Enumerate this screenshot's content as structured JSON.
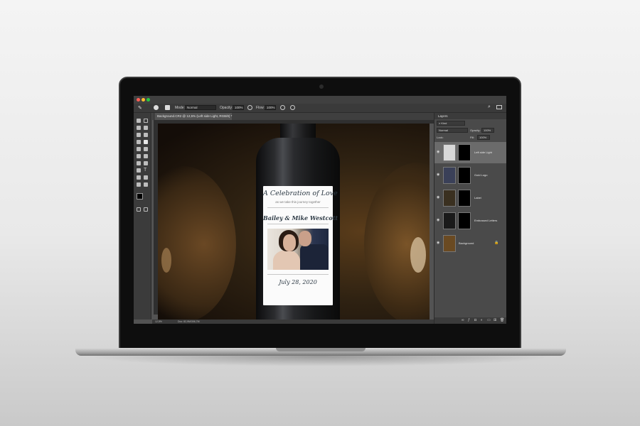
{
  "app": {
    "mode_label": "Mode:",
    "mode_value": "Normal",
    "opacity_label": "Opacity:",
    "opacity_value": "100%",
    "flow_label": "Flow:",
    "flow_value": "100%",
    "document_tab": "Background.CR2 @ 12,5% (Left side Light, RGB/8) *",
    "zoom": "12,5%",
    "doc_info": "Doc: 82,9M/306,7M"
  },
  "canvas": {
    "label_title": "A Celebration of Love",
    "label_subtitle": "as we take this journey together",
    "label_names": "Bailey & Mike Westcott",
    "label_date": "July 28, 2020"
  },
  "layers_panel": {
    "tab": "Layers",
    "kind_filter": "Kind",
    "blend_mode": "Normal",
    "opacity_label": "Opacity:",
    "opacity_value": "100%",
    "lock_label": "Lock:",
    "fill_label": "Fill:",
    "fill_value": "100%",
    "layers": [
      {
        "name": "Left side Light",
        "selected": true
      },
      {
        "name": "Gold Logo",
        "selected": false
      },
      {
        "name": "Label",
        "selected": false
      },
      {
        "name": "Embossed Letters",
        "selected": false
      },
      {
        "name": "Background",
        "selected": false
      }
    ]
  },
  "colors": {
    "app_bg": "#535353",
    "panel_bg": "#4a4a4a",
    "selected_layer": "#6b6b6b",
    "label_ink": "#2d3a45"
  }
}
